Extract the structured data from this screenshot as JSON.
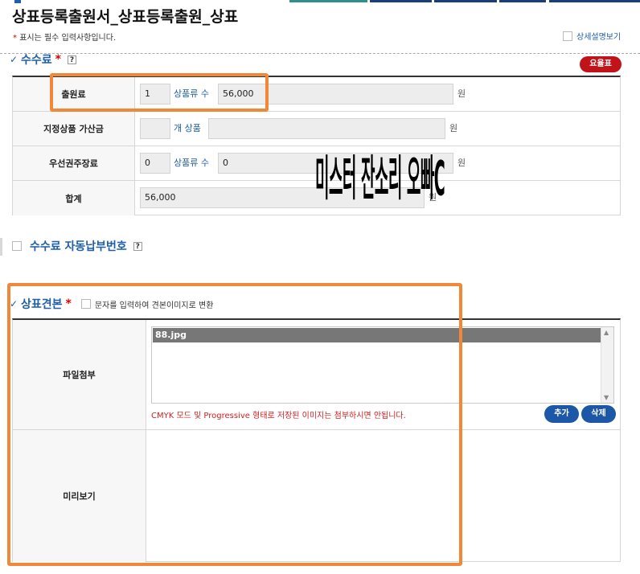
{
  "header": {
    "title": "상표등록출원서_상표등록출원_상표",
    "required_note_star": "*",
    "required_note": "표시는 필수 입력사항입니다.",
    "detail_toggle_label": "상세설명보기"
  },
  "fee_section": {
    "title": "수수료",
    "required_star": "*",
    "help": "?",
    "fee_table_button": "요율표",
    "rows": [
      {
        "label": "출원료",
        "count_value": "1",
        "inline_label": "상품류 수",
        "amount_value": "56,000",
        "unit": "원"
      },
      {
        "label": "지정상품 가산금",
        "count_value": "",
        "inline_label": "개 상품",
        "amount_value": "",
        "unit": "원"
      },
      {
        "label": "우선권주장료",
        "count_value": "0",
        "inline_label": "상품류 수",
        "amount_value": "0",
        "unit": "원"
      },
      {
        "label": "합계",
        "amount_value": "56,000",
        "unit": "원"
      }
    ]
  },
  "auto_payment": {
    "label": "수수료 자동납부번호",
    "help": "?"
  },
  "sample_section": {
    "title": "상표견본",
    "required_star": "*",
    "convert_label": "문자를 입력하여 견본이미지로 변환",
    "file_label": "파일첨부",
    "files": [
      "88.jpg"
    ],
    "warning": "CMYK 모드 및 Progressive 형태로 저장된 이미지는 첨부하시면 안됩니다.",
    "add_button": "추가",
    "delete_button": "삭제",
    "preview_label": "미리보기",
    "preview_text": "미스터 잔소리 오빠C"
  },
  "colors": {
    "accent_blue": "#1f5ea8",
    "button_red": "#c0141a",
    "button_blue": "#1c57a8",
    "highlight_orange": "#f08838",
    "warning_red": "#d02020"
  }
}
